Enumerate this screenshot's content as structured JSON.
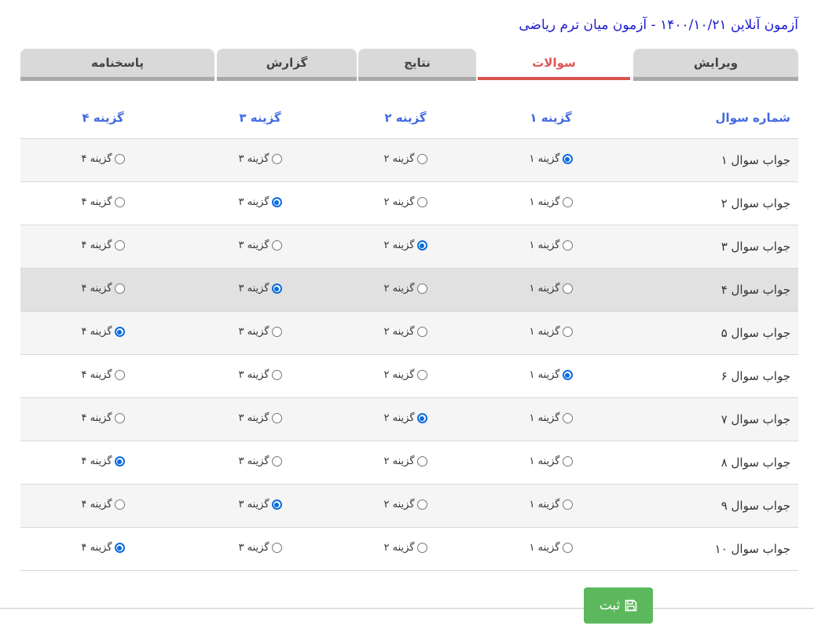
{
  "header": {
    "title": "آزمون آنلاین ۱۴۰۰/۱۰/۲۱ - آزمون میان ترم ریاضی"
  },
  "tabs": [
    {
      "label": "ویرایش",
      "active": false
    },
    {
      "label": "سوالات",
      "active": true
    },
    {
      "label": "نتایج",
      "active": false
    },
    {
      "label": "گزارش",
      "active": false
    },
    {
      "label": "پاسخنامه",
      "active": false
    }
  ],
  "table": {
    "headers": [
      "شماره سوال",
      "گزینه ۱",
      "گزینه ۲",
      "گزینه ۳",
      "گزینه ۴"
    ],
    "options": [
      "گزینه ۱",
      "گزینه ۲",
      "گزینه ۳",
      "گزینه ۴"
    ],
    "rows": [
      {
        "label": "جواب سوال ۱",
        "selected": 1
      },
      {
        "label": "جواب سوال ۲",
        "selected": 3
      },
      {
        "label": "جواب سوال ۳",
        "selected": 2
      },
      {
        "label": "جواب سوال ۴",
        "selected": 3
      },
      {
        "label": "جواب سوال ۵",
        "selected": 4
      },
      {
        "label": "جواب سوال ۶",
        "selected": 1
      },
      {
        "label": "جواب سوال ۷",
        "selected": 2
      },
      {
        "label": "جواب سوال ۸",
        "selected": 4
      },
      {
        "label": "جواب سوال ۹",
        "selected": 3
      },
      {
        "label": "جواب سوال ۱۰",
        "selected": 4
      }
    ]
  },
  "actions": {
    "save_label": "ثبت",
    "save_icon": "floppy-disk-icon"
  },
  "colors": {
    "title": "#1c1ccf",
    "header_text": "#4169e1",
    "active_tab_text": "#e05555",
    "active_tab_border": "#d9534f",
    "save_button": "#5cb85c",
    "radio_checked": "#0a6cde"
  }
}
